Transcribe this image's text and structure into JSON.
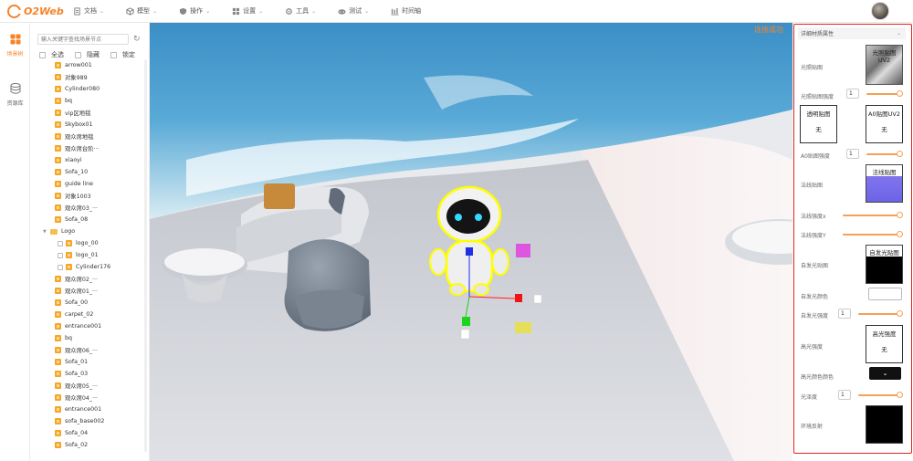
{
  "app": {
    "logo_text": "O2Web"
  },
  "menu": [
    {
      "label": "文档",
      "icon": "document-icon"
    },
    {
      "label": "模型",
      "icon": "cube-icon"
    },
    {
      "label": "操作",
      "icon": "shield-icon"
    },
    {
      "label": "设置",
      "icon": "grid-icon"
    },
    {
      "label": "工具",
      "icon": "gear-icon"
    },
    {
      "label": "测试",
      "icon": "gamepad-icon"
    },
    {
      "label": "时间轴",
      "icon": "timeline-icon"
    }
  ],
  "rail": [
    {
      "label": "场景树",
      "icon": "grid-icon",
      "active": true
    },
    {
      "label": "资源库",
      "icon": "database-icon",
      "active": false
    }
  ],
  "tree": {
    "search_placeholder": "输入关键字查找场景节点",
    "options": [
      "全选",
      "隐藏",
      "锁定"
    ],
    "nodes": [
      {
        "label": "arrow001",
        "type": "object",
        "indent": 0
      },
      {
        "label": "对象989",
        "type": "object",
        "indent": 0
      },
      {
        "label": "Cylinder080",
        "type": "object",
        "indent": 0
      },
      {
        "label": "bq",
        "type": "object",
        "indent": 0
      },
      {
        "label": "vip区地毯",
        "type": "object",
        "indent": 0
      },
      {
        "label": "Skybox01",
        "type": "object",
        "indent": 0
      },
      {
        "label": "观众席地毯",
        "type": "object",
        "indent": 0
      },
      {
        "label": "观众席台阶···",
        "type": "object",
        "indent": 0
      },
      {
        "label": "xiaoyi",
        "type": "object",
        "indent": 0
      },
      {
        "label": "Sofa_10",
        "type": "object",
        "indent": 0
      },
      {
        "label": "guide line",
        "type": "object",
        "indent": 0
      },
      {
        "label": "对象1003",
        "type": "object",
        "indent": 0
      },
      {
        "label": "观众席03_···",
        "type": "object",
        "indent": 0
      },
      {
        "label": "Sofa_08",
        "type": "object",
        "indent": 0
      },
      {
        "label": "Logo",
        "type": "folder",
        "indent": 0
      },
      {
        "label": "logo_00",
        "type": "object",
        "indent": 1
      },
      {
        "label": "logo_01",
        "type": "object",
        "indent": 1
      },
      {
        "label": "Cylinder176",
        "type": "object",
        "indent": 1
      },
      {
        "label": "观众席02_···",
        "type": "object",
        "indent": 0
      },
      {
        "label": "观众席01_···",
        "type": "object",
        "indent": 0
      },
      {
        "label": "Sofa_00",
        "type": "object",
        "indent": 0
      },
      {
        "label": "carpet_02",
        "type": "object",
        "indent": 0
      },
      {
        "label": "entrance001",
        "type": "object",
        "indent": 0
      },
      {
        "label": "bq",
        "type": "object",
        "indent": 0
      },
      {
        "label": "观众席06_···",
        "type": "object",
        "indent": 0
      },
      {
        "label": "Sofa_01",
        "type": "object",
        "indent": 0
      },
      {
        "label": "Sofa_03",
        "type": "object",
        "indent": 0
      },
      {
        "label": "观众席05_···",
        "type": "object",
        "indent": 0
      },
      {
        "label": "观众席04_···",
        "type": "object",
        "indent": 0
      },
      {
        "label": "entrance001",
        "type": "object",
        "indent": 0
      },
      {
        "label": "sofa_base002",
        "type": "object",
        "indent": 0
      },
      {
        "label": "Sofa_04",
        "type": "object",
        "indent": 0
      },
      {
        "label": "Sofa_02",
        "type": "object",
        "indent": 0
      }
    ]
  },
  "viewport": {
    "status": "连接成功"
  },
  "props": {
    "header": "详细材质属性",
    "light_map_label": "光照贴图",
    "light_map_thumb": "光照贴图UV2",
    "light_map_strength_label": "光照贴图强度",
    "light_map_strength": "1",
    "opacity_map_title": "透明贴图",
    "opacity_map_value": "无",
    "ao_map_title": "A0贴图UV2",
    "ao_map_value": "无",
    "ao_strength_label": "A0贴图强度",
    "ao_strength": "1",
    "normal_map_label": "法线贴图",
    "normal_map_thumb": "法线贴图",
    "normal_strength_x_label": "法线强度x",
    "normal_strength_y_label": "法线强度Y",
    "emissive_map_label": "自发光贴图",
    "emissive_map_thumb": "自发光贴图",
    "emissive_color_label": "自发光颜色",
    "emissive_intensity_label": "自发光强度",
    "emissive_intensity": "1",
    "specular_label": "高光强度",
    "specular_title": "高光强度",
    "specular_value": "无",
    "specular_color_label": "高光颜色颜色",
    "gloss_label": "光泽度",
    "gloss_value": "1",
    "env_reflect_label": "环境反射",
    "colors": {
      "accent": "#f5832a",
      "slider": "#f5a057",
      "panel_border": "#e0251b"
    }
  }
}
